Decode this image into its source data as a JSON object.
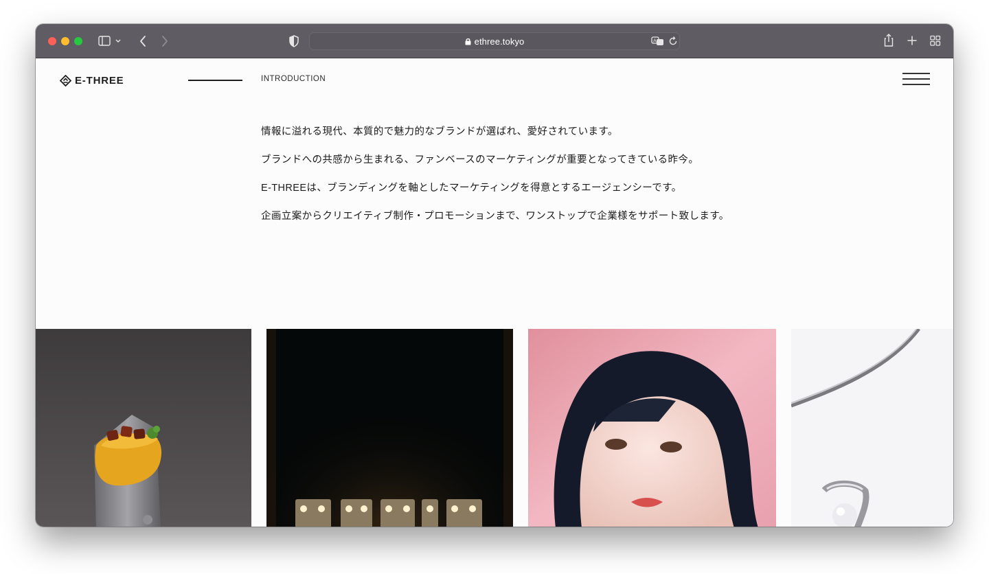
{
  "browser": {
    "url": "ethree.tokyo",
    "icons": {
      "sidebar": "sidebar-icon",
      "back": "chevron-left-icon",
      "forward": "chevron-right-icon",
      "privacy": "shield-icon",
      "lock": "lock-icon",
      "translate": "translate-icon",
      "reload": "reload-icon",
      "share": "share-icon",
      "new_tab": "plus-icon",
      "tab_overview": "tab-grid-icon"
    }
  },
  "site": {
    "logo_text": "E-THREE",
    "nav_label": "INTRODUCTION",
    "intro": [
      "情報に溢れる現代、本質的で魅力的なブランドが選ばれ、愛好されています。",
      "ブランドへの共感から生まれる、ファンベースのマーケティングが重要となってきている昨今。",
      "E-THREEは、ブランディングを軸としたマーケティングを得意とするエージェンシーです。",
      "企画立案からクリエイティブ制作・プロモーションまで、ワンストップで企業様をサポート致します。"
    ],
    "gallery": [
      {
        "subject": "food-crepe-photo"
      },
      {
        "subject": "marquee-letters-photo"
      },
      {
        "subject": "portrait-photo"
      },
      {
        "subject": "jewelry-photo"
      }
    ]
  }
}
